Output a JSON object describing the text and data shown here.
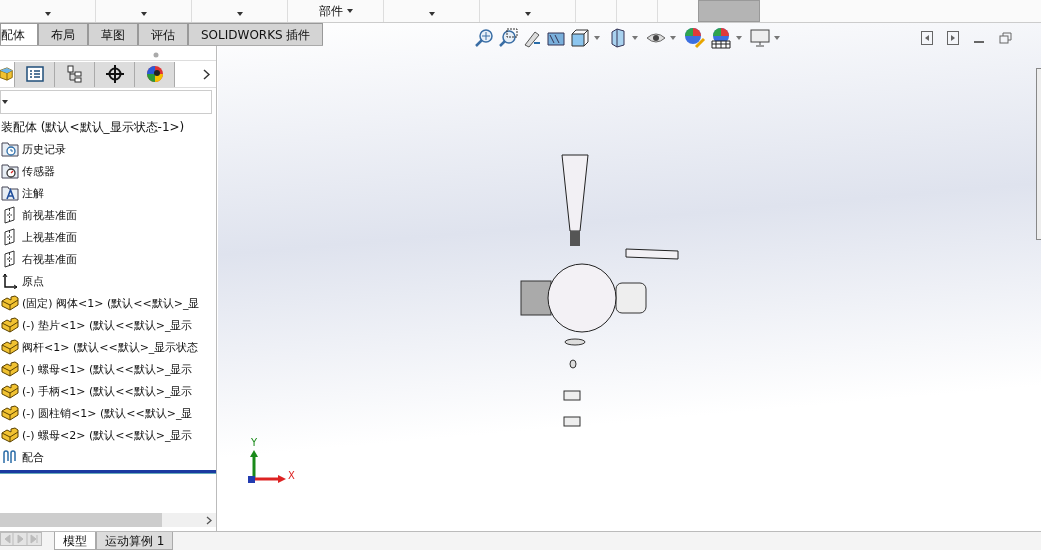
{
  "ribbon": {
    "label": "部件"
  },
  "tabs": [
    {
      "label": "配体",
      "selected": true
    },
    {
      "label": "布局",
      "selected": false
    },
    {
      "label": "草图",
      "selected": false
    },
    {
      "label": "评估",
      "selected": false
    },
    {
      "label": "SOLIDWORKS 插件",
      "selected": false
    }
  ],
  "panel_tabs": [
    {
      "kind": "assembly",
      "selected": true
    },
    {
      "kind": "property",
      "selected": false
    },
    {
      "kind": "config",
      "selected": false
    },
    {
      "kind": "target",
      "selected": false
    },
    {
      "kind": "appearance",
      "selected": false
    }
  ],
  "tree": {
    "root": "装配体  (默认<默认_显示状态-1>)",
    "items": [
      {
        "kind": "history",
        "label": "历史记录"
      },
      {
        "kind": "sensor",
        "label": "传感器"
      },
      {
        "kind": "annotation",
        "label": "注解"
      },
      {
        "kind": "plane",
        "label": "前视基准面"
      },
      {
        "kind": "plane",
        "label": "上视基准面"
      },
      {
        "kind": "plane",
        "label": "右视基准面"
      },
      {
        "kind": "origin",
        "label": "原点"
      },
      {
        "kind": "part",
        "label": "(固定) 阀体<1> (默认<<默认>_显"
      },
      {
        "kind": "part",
        "label": "(-) 垫片<1> (默认<<默认>_显示"
      },
      {
        "kind": "part",
        "label": "阀杆<1> (默认<<默认>_显示状态"
      },
      {
        "kind": "part",
        "label": "(-) 螺母<1> (默认<<默认>_显示"
      },
      {
        "kind": "part",
        "label": "(-) 手柄<1> (默认<<默认>_显示"
      },
      {
        "kind": "part",
        "label": "(-) 圆柱销<1> (默认<<默认>_显"
      },
      {
        "kind": "part",
        "label": "(-) 螺母<2> (默认<<默认>_显示"
      },
      {
        "kind": "mate",
        "label": "配合"
      }
    ]
  },
  "axes": {
    "y": "Y",
    "x": "X"
  },
  "bottom_tabs": [
    {
      "label": "模型",
      "selected": true
    },
    {
      "label": "运动算例 1",
      "selected": false
    }
  ]
}
